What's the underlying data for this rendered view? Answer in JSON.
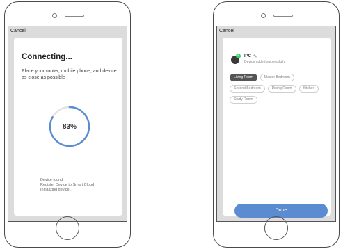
{
  "left_phone": {
    "cancel_label": "Cancel",
    "title": "Connecting...",
    "description": "Place your router, mobile phone, and device as close as possible",
    "progress_text": "83%",
    "progress_fraction": 0.83,
    "progress_color": "#5b8bd1",
    "progress_track_color": "#e2e2e2",
    "status_lines": [
      "Device found",
      "Register Device to Smart Cloud",
      "Initializing device..."
    ]
  },
  "right_phone": {
    "cancel_label": "Cancel",
    "device_name": "IPC",
    "device_status": "Device added successfully",
    "rooms": [
      "Living Room",
      "Master Bedroom",
      "Second Bedroom",
      "Dining Room",
      "Kitchen",
      "Study Room"
    ],
    "selected_room": "Living Room",
    "done_label": "Done",
    "accent_color": "#5b8bd1",
    "success_color": "#3ecf68"
  }
}
